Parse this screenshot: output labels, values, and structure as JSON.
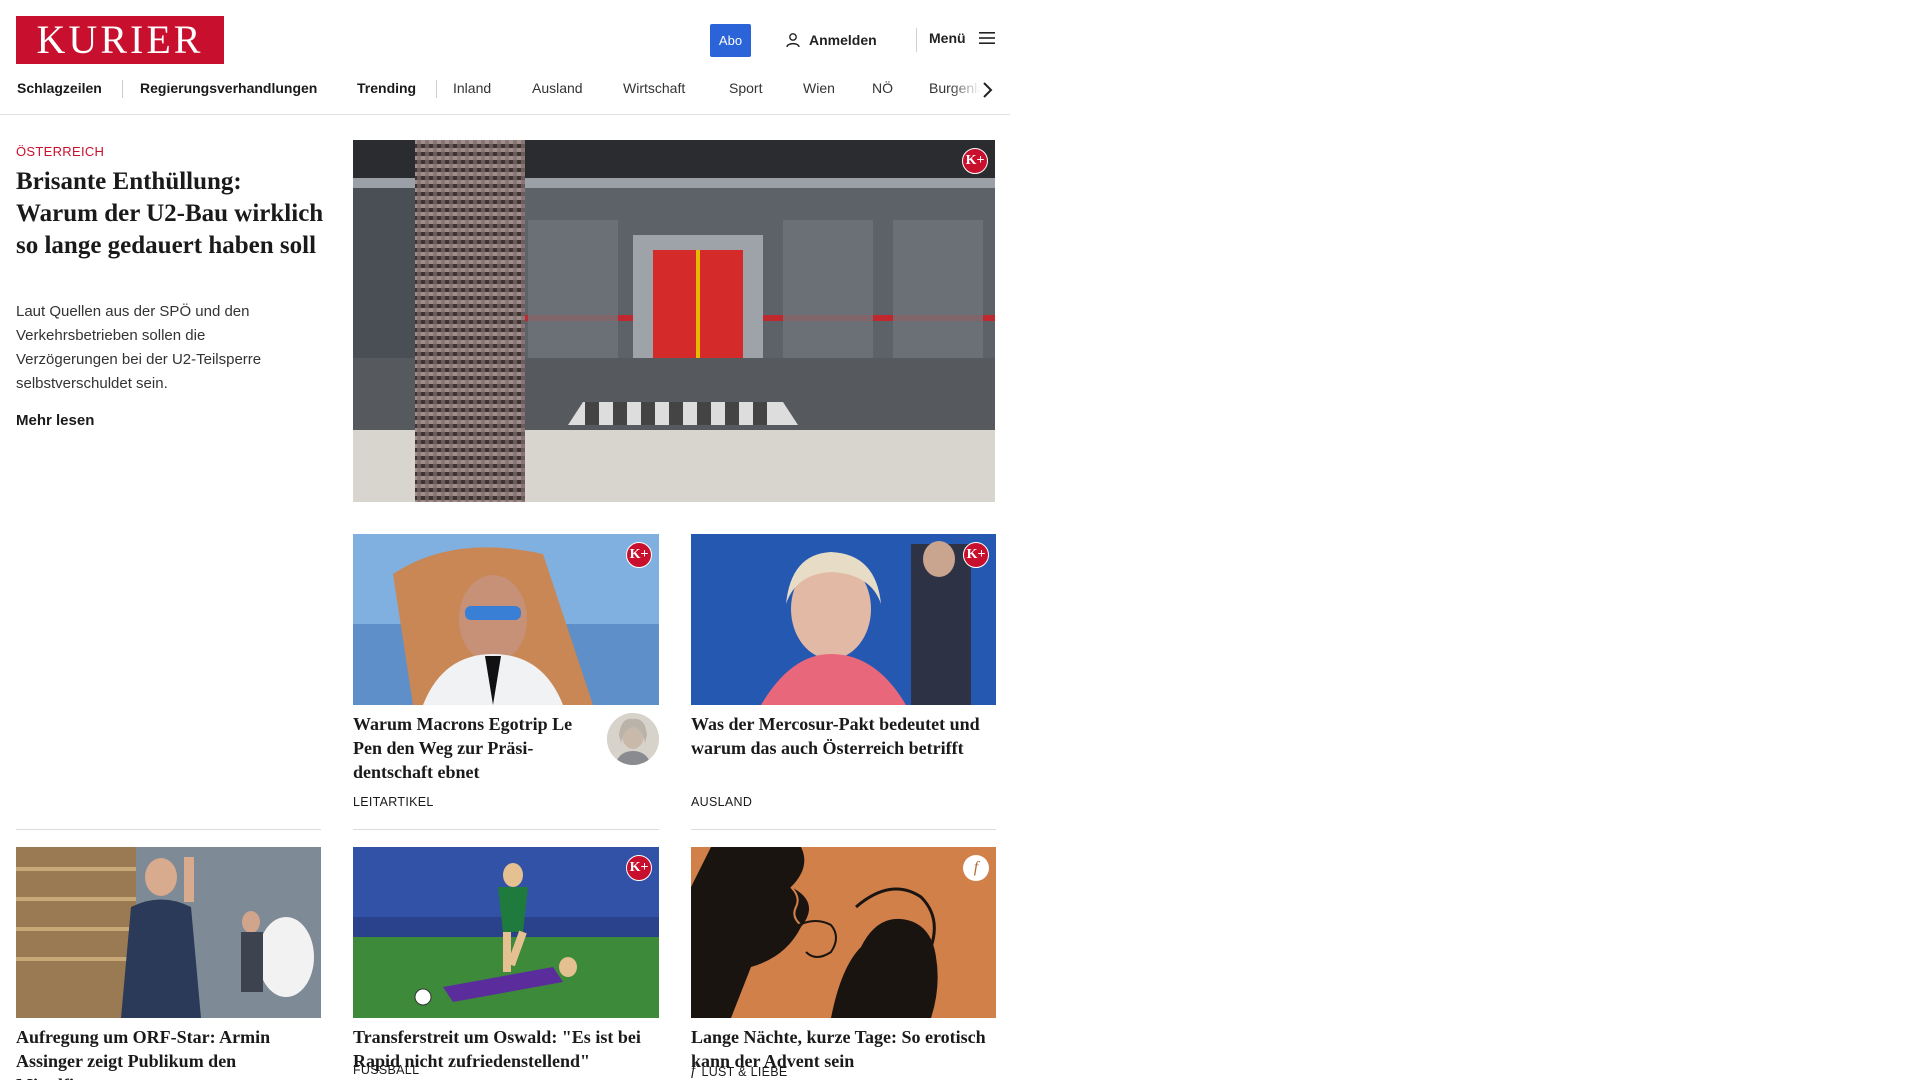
{
  "brand": {
    "logo_text": "KURIER",
    "color": "#c8102e"
  },
  "header": {
    "abo_label": "Abo",
    "login_label": "Anmelden",
    "menu_label": "Menü"
  },
  "nav": {
    "items": [
      {
        "label": "Schlagzeilen"
      },
      {
        "label": "Regierungsverhandlungen"
      },
      {
        "label": "Trending"
      },
      {
        "label": "Inland"
      },
      {
        "label": "Ausland"
      },
      {
        "label": "Wirtschaft"
      },
      {
        "label": "Sport"
      },
      {
        "label": "Wien"
      },
      {
        "label": "NÖ"
      },
      {
        "label": "Burgenland"
      }
    ]
  },
  "lead": {
    "kicker": "ÖSTERREICH",
    "title": "Brisante Enthüllung: Warum der U2-Bau wirk­lich so lange gedauert ha­ben soll",
    "teaser": "Laut Quellen aus der SPÖ und den Verkehrsbetrieben sollen die Verzögerungen bei der U2-Teilsperre selbstverschuldet sein.",
    "more_label": "Mehr lesen",
    "badge": "K+"
  },
  "cards": [
    {
      "title": "Warum Macrons Egotrip Le Pen den Weg zur Präsi­dentschaft ebnet",
      "tag": "LEITARTIKEL",
      "badge": "K+"
    },
    {
      "title": "Was der Mercosur-Pakt bedeutet und warum das auch Österreich betrifft",
      "tag": "AUSLAND",
      "badge": "K+"
    },
    {
      "title": "Aufregung um ORF-Star: Armin Assinger zeigt Publikum den Mittelfinger",
      "tag": ""
    },
    {
      "title": "Transferstreit um Oswald: \"Es ist bei Rapid nicht zufriedenstellend\"",
      "tag": "FUSSBALL",
      "badge": "K+"
    },
    {
      "title": "Lange Nächte, kurze Tage: So ero­tisch kann der Advent sein",
      "tag": "LUST & LIEBE",
      "badge": "f"
    }
  ],
  "colors": {
    "accent": "#c8102e",
    "abo_button": "#2b63d9"
  }
}
